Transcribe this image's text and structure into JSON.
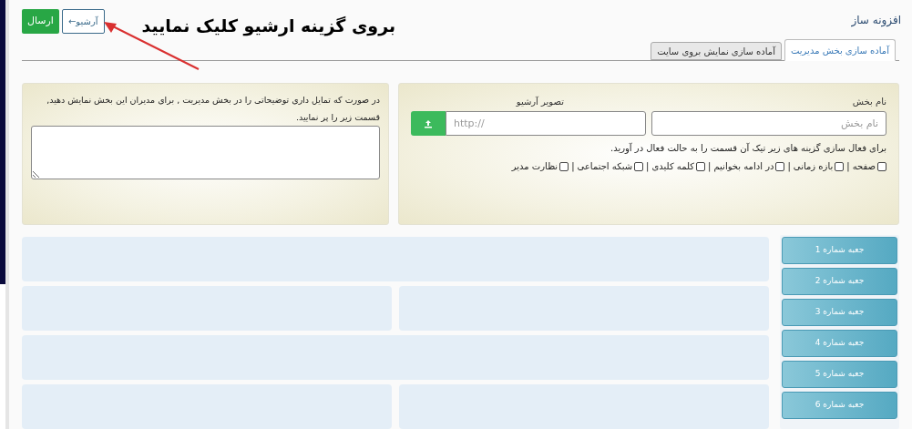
{
  "header": {
    "title": "افزونه ساز",
    "send_button": "ارسال",
    "archive_button": "آرشیو←",
    "annotation": "بروی گزینه ارشیو کلیک نمایید"
  },
  "tabs": [
    {
      "label": "آماده سازی بخش مدیریت",
      "selected": true
    },
    {
      "label": "آماده سازی نمایش بروی سایت",
      "selected": false
    }
  ],
  "section_form": {
    "name_label": "نام بخش",
    "name_placeholder": "نام بخش",
    "image_label": "تصویر آرشیو",
    "image_placeholder": "http://",
    "hint": "برای فعال سازی گزینه های زیر تیک آن قسمت را به حالت فعال در آورید.",
    "options": [
      {
        "label": "صفحه",
        "checked": false
      },
      {
        "label": "بازه زمانی",
        "checked": false
      },
      {
        "label": "در ادامه بخوانیم",
        "checked": false
      },
      {
        "label": "کلمه کلیدی",
        "checked": false
      },
      {
        "label": "شبکه اجتماعی",
        "checked": false
      },
      {
        "label": "نظارت مدیر",
        "checked": false
      }
    ],
    "separator": "|"
  },
  "description_panel": {
    "text": "در صورت که تمایل داری توضیحاتی را در بخش مدیریت , برای مدیران این بخش نمایش دهید, قسمت زیر را پر نمایید."
  },
  "boxes": [
    "جعبه شماره 1",
    "جعبه شماره 2",
    "جعبه شماره 3",
    "جعبه شماره 4",
    "جعبه شماره 5",
    "جعبه شماره 6"
  ]
}
